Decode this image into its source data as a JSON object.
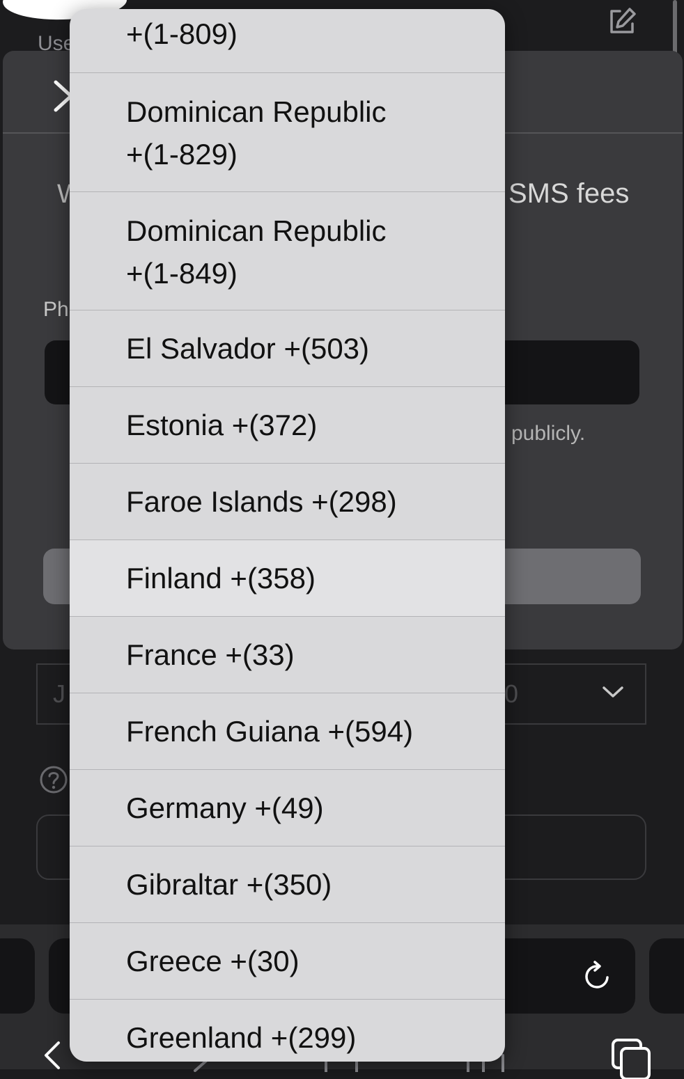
{
  "background": {
    "title_partial": "Use",
    "heading_partial": "W",
    "sms_fees": "SMS fees",
    "phone_label_partial": "Ph",
    "publicly": "publicly.",
    "select_left_partial": "J",
    "select_right_partial": "0"
  },
  "picker": {
    "options": [
      {
        "lines": [
          "+(1-809)"
        ]
      },
      {
        "lines": [
          "Dominican Republic",
          "+(1-829)"
        ]
      },
      {
        "lines": [
          "Dominican Republic",
          "+(1-849)"
        ]
      },
      {
        "lines": [
          "El Salvador +(503)"
        ]
      },
      {
        "lines": [
          "Estonia +(372)"
        ]
      },
      {
        "lines": [
          "Faroe Islands +(298)"
        ]
      },
      {
        "lines": [
          "Finland +(358)"
        ]
      },
      {
        "lines": [
          "France +(33)"
        ]
      },
      {
        "lines": [
          "French Guiana +(594)"
        ]
      },
      {
        "lines": [
          "Germany +(49)"
        ]
      },
      {
        "lines": [
          "Gibraltar +(350)"
        ]
      },
      {
        "lines": [
          "Greece +(30)"
        ]
      },
      {
        "lines": [
          "Greenland +(299)"
        ]
      }
    ]
  },
  "icons": {
    "edit": "edit-icon",
    "close": "close-icon",
    "chevron": "chevron-down-icon",
    "help": "help-icon",
    "reload": "reload-icon",
    "back": "back-icon",
    "tabs": "tabs-icon"
  },
  "colors": {
    "picker_background": "#d9d9db",
    "app_background": "#1c1c1e",
    "sheet_background": "#3a3a3d",
    "highlight": "#e2e2e4"
  }
}
